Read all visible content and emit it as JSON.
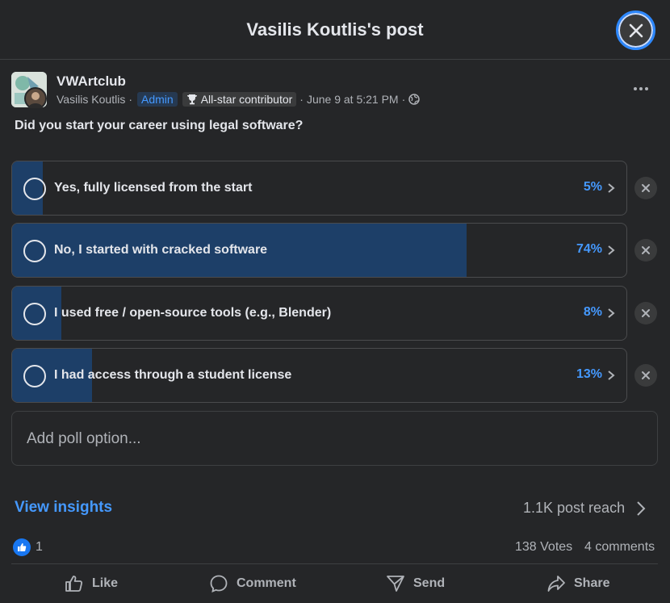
{
  "header": {
    "title": "Vasilis Koutlis's post",
    "close_icon": "close-icon"
  },
  "post": {
    "group_name": "VWArtclub",
    "author": "Vasilis Koutlis",
    "role_badge": "Admin",
    "contributor_badge": "All-star contributor",
    "timestamp": "June 9 at 5:21 PM",
    "sep": "·",
    "audience_icon": "globe-icon",
    "question": "Did you start your career using legal software?"
  },
  "poll": {
    "options": [
      {
        "label": "Yes, fully licensed from the start",
        "percent_text": "5%",
        "percent": 5
      },
      {
        "label": "No, I started with cracked software",
        "percent_text": "74%",
        "percent": 74
      },
      {
        "label": "I used free / open-source tools (e.g., Blender)",
        "percent_text": "8%",
        "percent": 8
      },
      {
        "label": "I had access through a student license",
        "percent_text": "13%",
        "percent": 13
      }
    ],
    "add_option_placeholder": "Add poll option..."
  },
  "insights": {
    "link": "View insights",
    "reach": "1.1K post reach"
  },
  "stats": {
    "likes": "1",
    "votes": "138 Votes",
    "comments": "4 comments"
  },
  "actions": {
    "like": "Like",
    "comment": "Comment",
    "send": "Send",
    "share": "Share"
  },
  "colors": {
    "accent": "#4599ff",
    "poll_fill": "#1d3f68",
    "background": "#252628",
    "like_blue": "#1877f2"
  }
}
